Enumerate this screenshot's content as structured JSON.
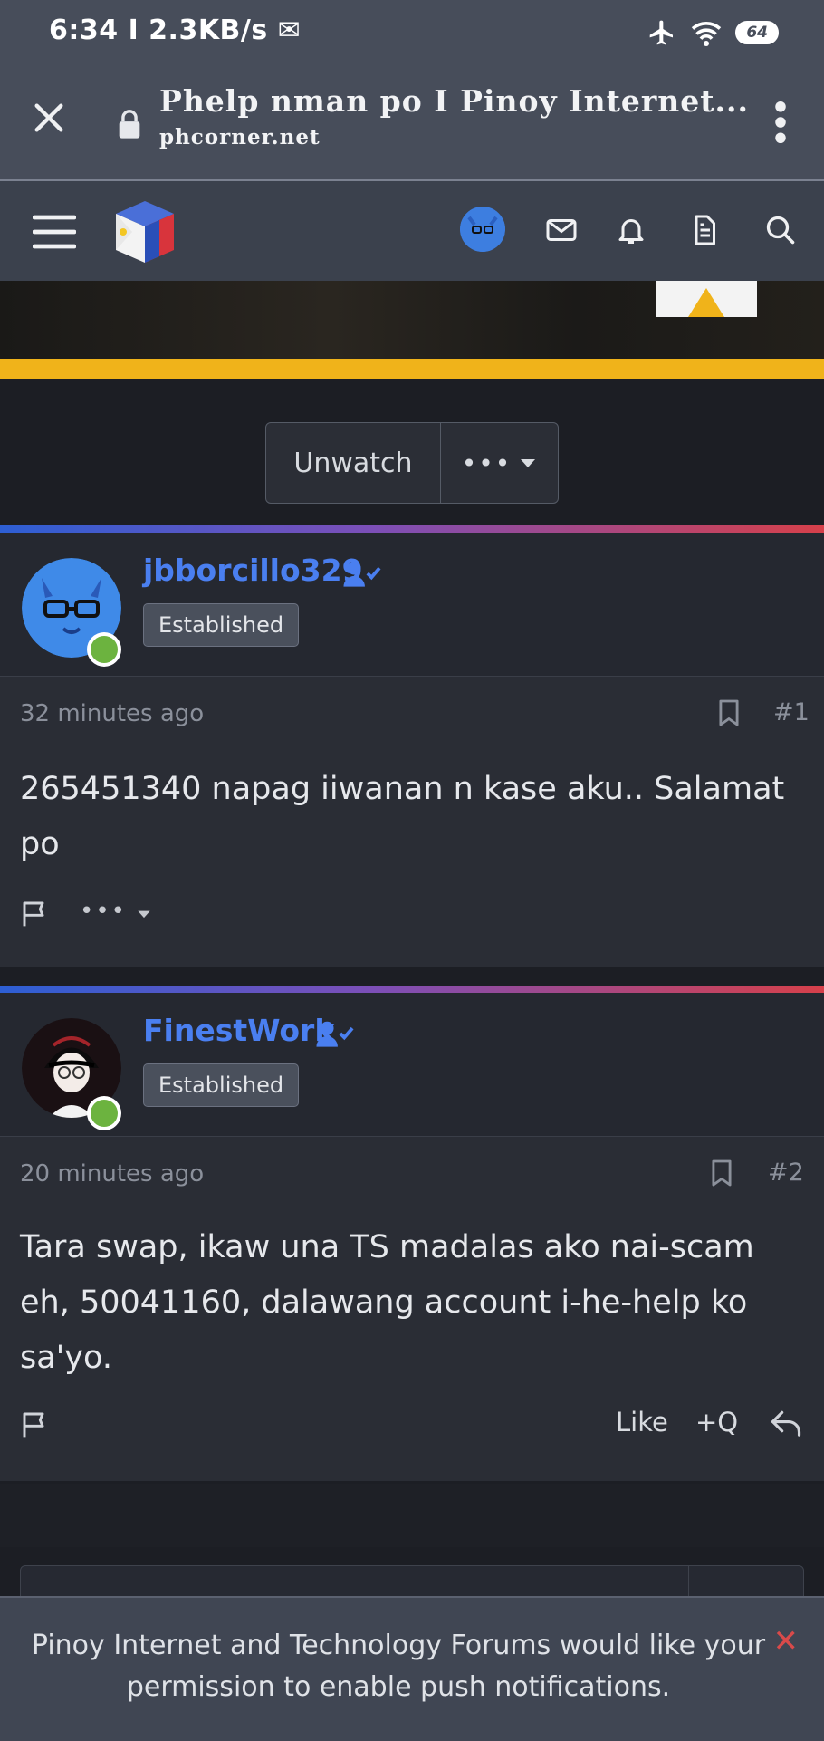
{
  "status_bar": {
    "time_text": "6:34 I 2.3KB/s ✉",
    "battery": "64"
  },
  "browser": {
    "title": "Phelp nman po I Pinoy Internet...",
    "url": "phcorner.net"
  },
  "thread": {
    "unwatch_label": "Unwatch",
    "more_label": "•••"
  },
  "posts": [
    {
      "username": "jbborcillo329",
      "badge": "Established",
      "time": "32 minutes ago",
      "number": "#1",
      "text": "265451340 napag iiwanan n kase aku.. Salamat po",
      "more_label": "•••"
    },
    {
      "username": "FinestWork",
      "badge": "Established",
      "time": "20 minutes ago",
      "number": "#2",
      "text": "Tara swap, ikaw una TS madalas ako nai-scam eh, 50041160, dalawang account i-he-help ko sa'yo.",
      "like_label": "Like",
      "quote_label": "+Q"
    }
  ],
  "notification": {
    "text": "Pinoy Internet and Technology Forums would like your permission to enable push notifications.",
    "close": "✕"
  },
  "colors": {
    "accent": "#4a7ff0",
    "online": "#6cb33f",
    "header_bg": "#3b414d"
  }
}
